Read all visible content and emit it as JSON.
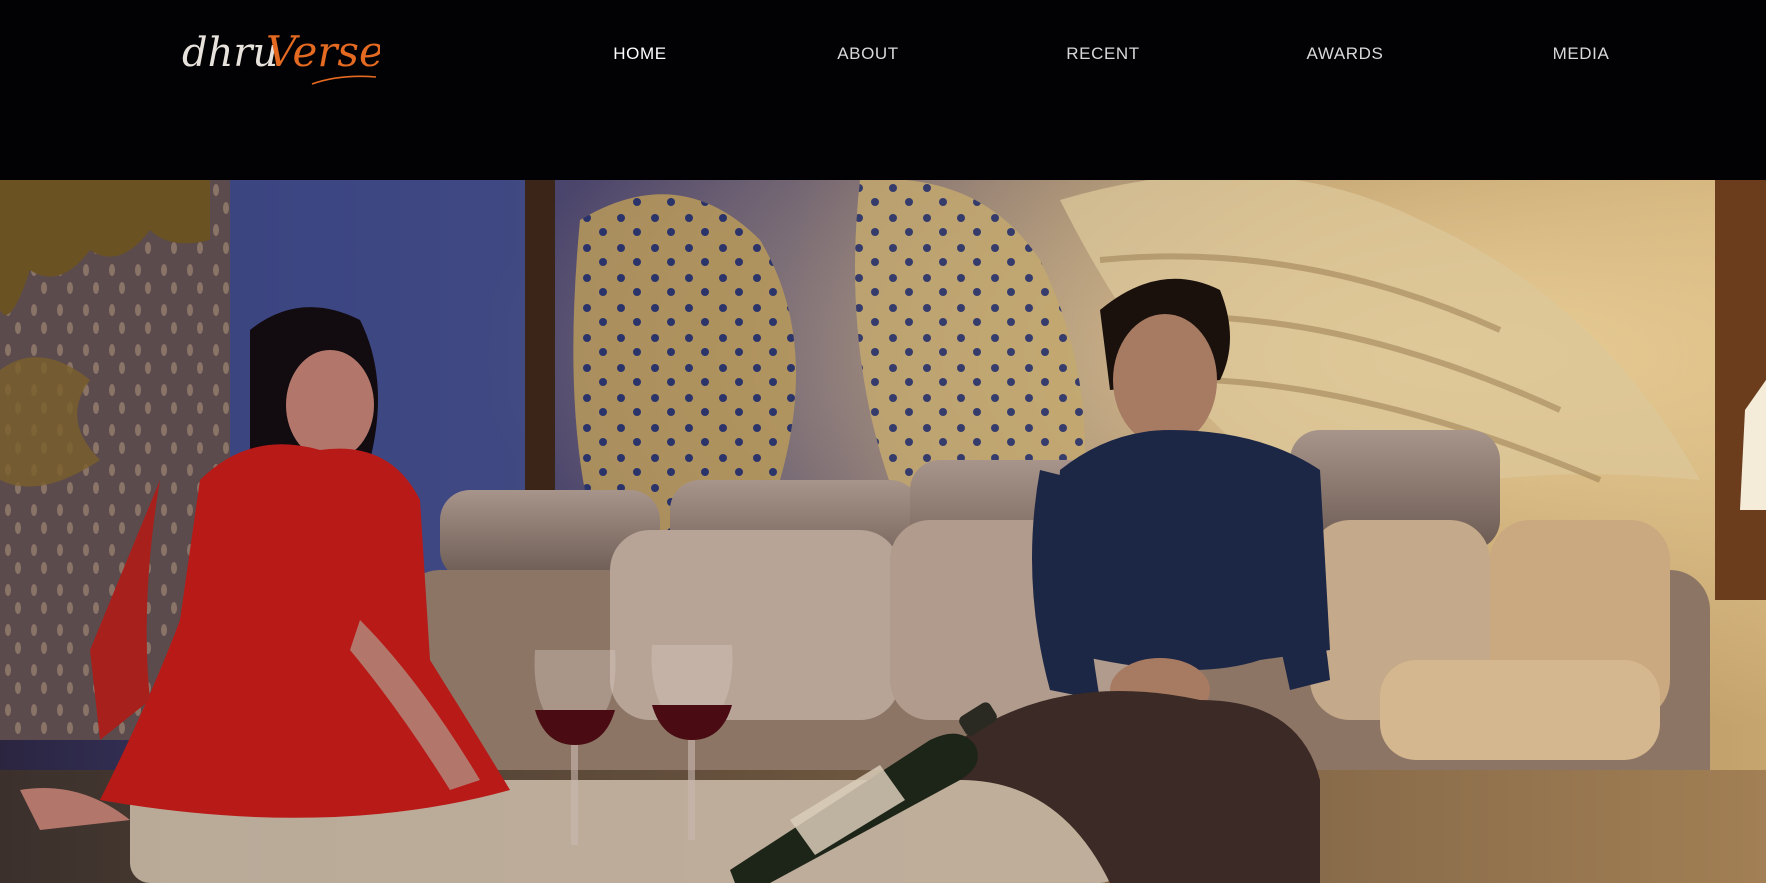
{
  "logo": {
    "part1": "dhru",
    "part2": "Verse",
    "part1_color": "#e8e2dc",
    "part2_color": "#e46a22"
  },
  "nav": {
    "items": [
      {
        "label": "HOME",
        "active": true
      },
      {
        "label": "ABOUT",
        "active": false
      },
      {
        "label": "RECENT",
        "active": false
      },
      {
        "label": "AWARDS",
        "active": false
      },
      {
        "label": "MEDIA",
        "active": false
      }
    ]
  },
  "colors": {
    "header_bg": "#020204",
    "nav_text": "#d8d8d8",
    "accent": "#e46a22"
  },
  "hero": {
    "icon": "film-still-image"
  }
}
